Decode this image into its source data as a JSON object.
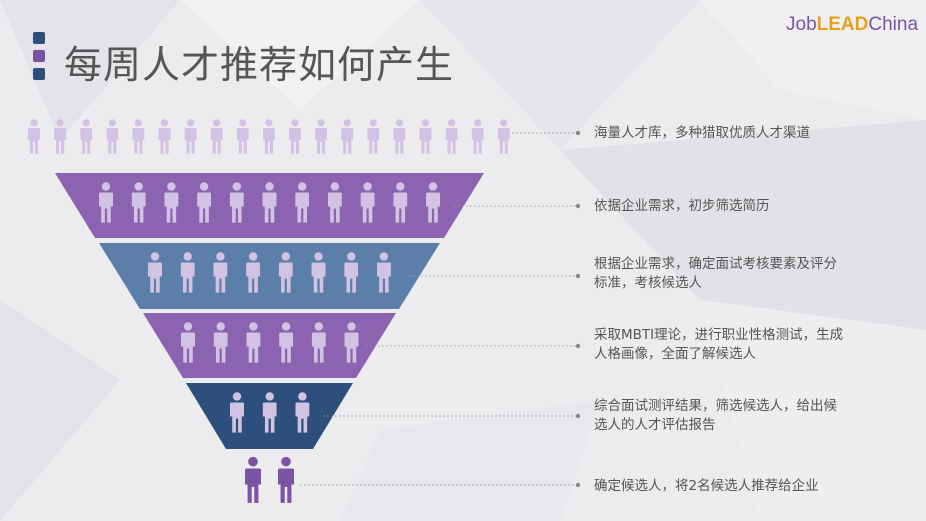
{
  "title": "每周人才推荐如何产生",
  "logo": {
    "part1": "Job",
    "part2": "LEAD",
    "part3": "China"
  },
  "colors": {
    "purple": "#8b63b0",
    "steel": "#5b7fa8",
    "navy": "#2d4f7c",
    "person_light": "#d2c2e3",
    "person_dark": "#7a54a4"
  },
  "stages": [
    {
      "text": "海量人才库，多种猎取优质人才渠道"
    },
    {
      "text": "依据企业需求，初步筛选简历"
    },
    {
      "text": "根据企业需求，确定面试考核要素及评分\n标准，考核候选人"
    },
    {
      "text": "采取MBTI理论，进行职业性格测试，生成\n人格画像，全面了解候选人"
    },
    {
      "text": "综合面试测评结果，筛选候选人，给出候\n选人的人才评估报告"
    },
    {
      "text": "确定候选人，将2名候选人推荐给企业"
    }
  ]
}
